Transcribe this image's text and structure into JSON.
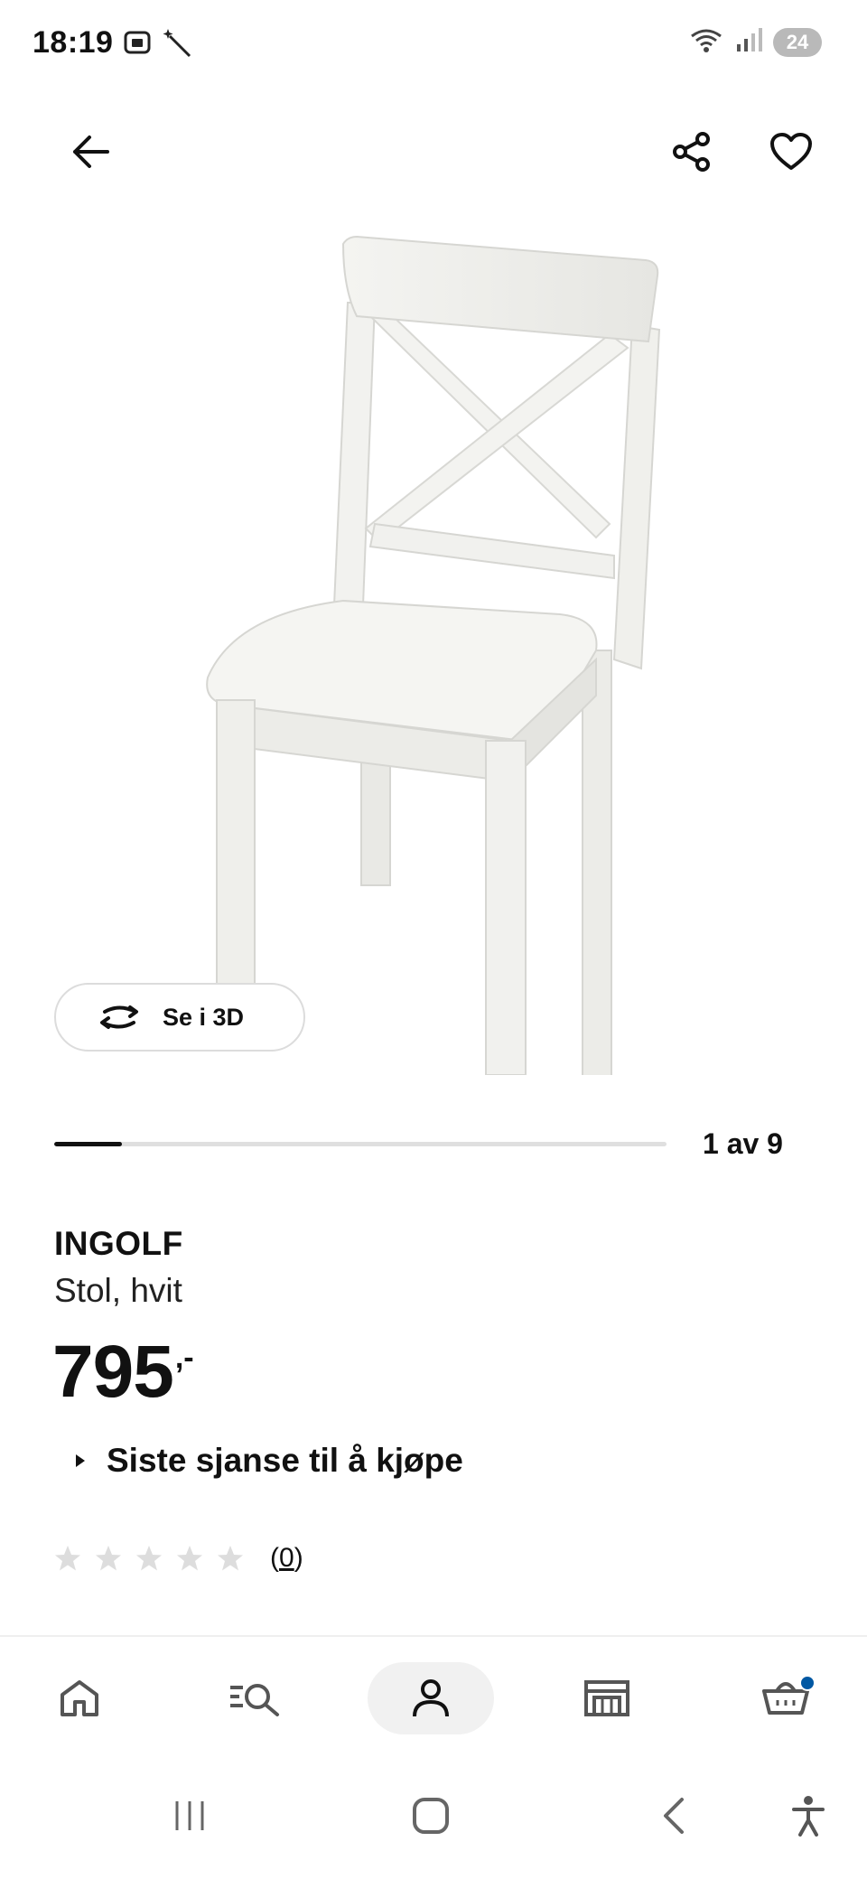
{
  "status_bar": {
    "time": "18:19",
    "battery": "24",
    "left_icons": [
      "screenshot-icon",
      "magic-wand-icon"
    ],
    "right_icons": [
      "wifi-icon",
      "signal-icon",
      "battery-icon"
    ]
  },
  "top_nav": {
    "back_icon": "arrow-left-icon",
    "share_icon": "share-icon",
    "favorite_icon": "heart-icon"
  },
  "gallery": {
    "view_3d_label": "Se i 3D",
    "counter": "1 av 9",
    "current": 1,
    "total": 9,
    "progress_fraction": 0.11
  },
  "product": {
    "name": "INGOLF",
    "description": "Stol, hvit",
    "price_integer": "795",
    "price_decimal": ",-",
    "availability_note": "Siste sjanse til å kjøpe",
    "rating_stars": 0,
    "rating_max": 5,
    "review_count": "0"
  },
  "bottom_nav": {
    "tabs": [
      {
        "name": "home",
        "icon": "home-icon"
      },
      {
        "name": "search",
        "icon": "search-list-icon"
      },
      {
        "name": "profile",
        "icon": "profile-icon",
        "active": true
      },
      {
        "name": "store",
        "icon": "store-icon"
      },
      {
        "name": "cart",
        "icon": "cart-icon",
        "badge": true
      }
    ]
  },
  "colors": {
    "text": "#111111",
    "star_empty": "#dddddd",
    "cart_badge": "#0058a3",
    "active_tab_bg": "#f1f1f1"
  }
}
